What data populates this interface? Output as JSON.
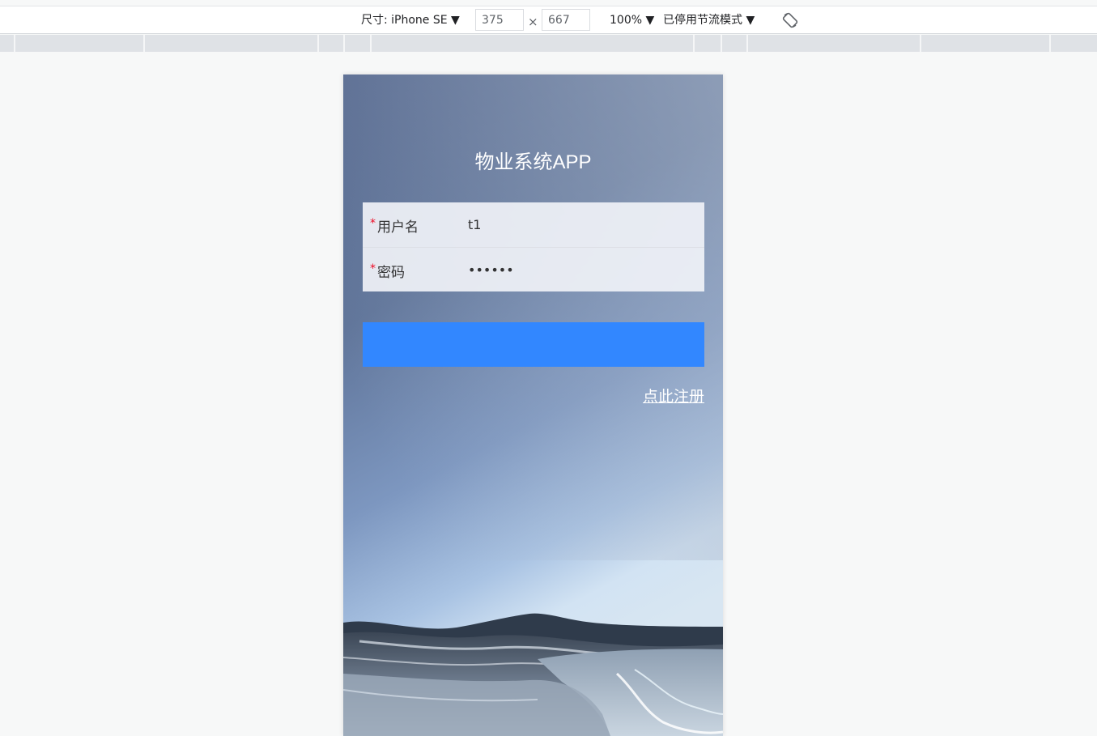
{
  "devtools": {
    "device_label": "尺寸: iPhone SE ▼",
    "width_value": "375",
    "height_value": "667",
    "times_symbol": "×",
    "zoom_label": "100% ▼",
    "throttle_label": "已停用节流模式 ▼",
    "rotate_icon": "rotate-icon"
  },
  "app": {
    "title": "物业系统APP",
    "form": {
      "username": {
        "required_mark": "*",
        "label": "用户名",
        "value": "t1"
      },
      "password": {
        "required_mark": "*",
        "label": "密码",
        "value": "••••••"
      }
    },
    "login_button_label": "",
    "register_link": "点此注册"
  },
  "colors": {
    "primary_button": "#3287ff",
    "required_mark": "#ee0a24",
    "title_text": "#ffffff"
  }
}
